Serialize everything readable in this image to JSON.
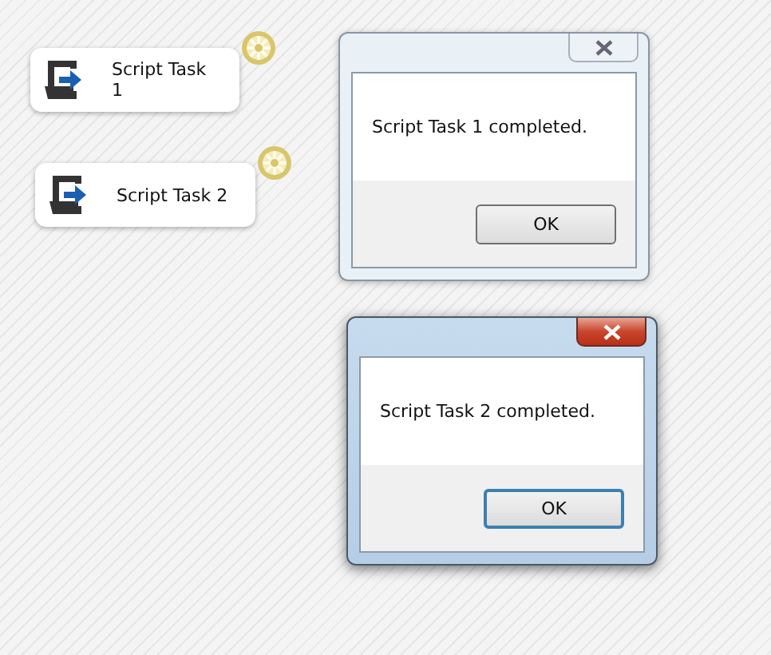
{
  "nodes": [
    {
      "label": "Script Task 1"
    },
    {
      "label": "Script Task 2"
    }
  ],
  "dialogs": [
    {
      "message": "Script Task 1 completed.",
      "button": "OK",
      "active": false
    },
    {
      "message": "Script Task 2 completed.",
      "button": "OK",
      "active": true
    }
  ]
}
